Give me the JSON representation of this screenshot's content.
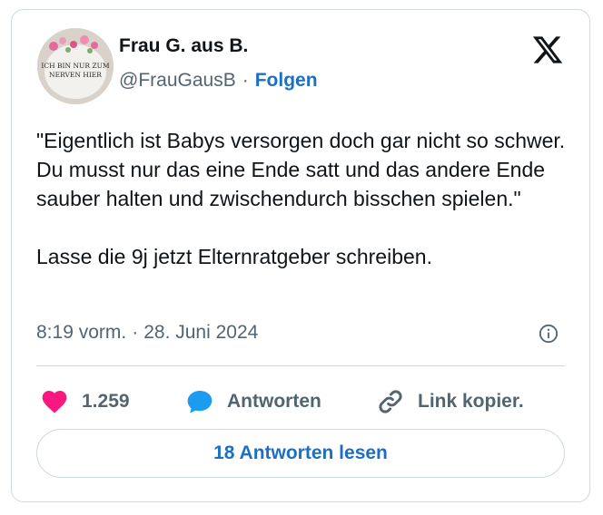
{
  "author": {
    "name": "Frau G. aus B.",
    "handle": "@FrauGausB",
    "separator": "·",
    "follow_label": "Folgen",
    "avatar_text_line1": "ICH BIN NUR ZUM",
    "avatar_text_line2": "NERVEN HIER"
  },
  "logo_icon": "x-logo-icon",
  "tweet": {
    "text": "\"Eigentlich ist Babys versorgen doch gar nicht so schwer. Du musst nur das eine Ende satt und das andere Ende sauber halten und zwischendurch bisschen spielen.\"\n\nLasse die 9j jetzt Elternratgeber schreiben.",
    "time": "8:19 vorm.",
    "separator": "·",
    "date": "28. Juni 2024"
  },
  "actions": {
    "likes": "1.259",
    "reply_label": "Antworten",
    "copy_label": "Link kopier."
  },
  "read_replies_label": "18 Antworten lesen",
  "colors": {
    "accent": "#1d6fc4",
    "like": "#f91880",
    "reply": "#1d9bf0",
    "muted": "#536471"
  }
}
